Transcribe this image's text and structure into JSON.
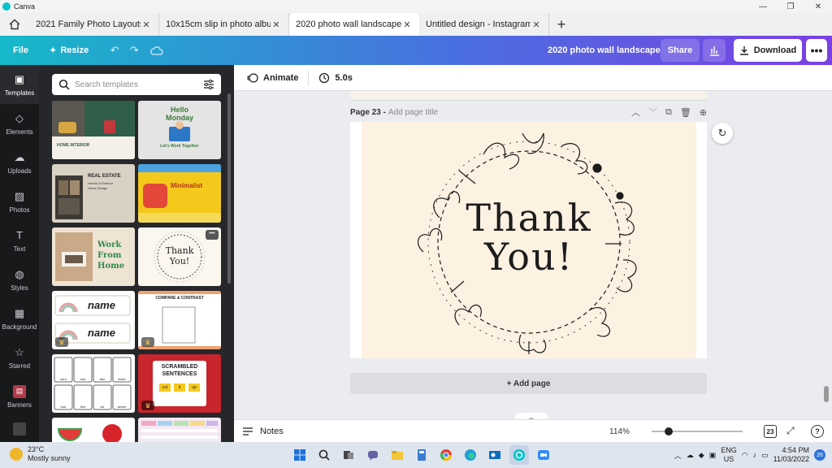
{
  "window": {
    "app_title": "Canva"
  },
  "tabs": [
    {
      "label": "2021 Family Photo Layouts",
      "active": false
    },
    {
      "label": "10x15cm slip in photo album",
      "active": false
    },
    {
      "label": "2020 photo wall landscape",
      "active": true
    },
    {
      "label": "Untitled design - Instagram",
      "active": false
    }
  ],
  "toolbar": {
    "file_label": "File",
    "resize_label": "Resize",
    "doc_title": "2020 photo wall landscape",
    "share_label": "Share",
    "download_label": "Download"
  },
  "sidebar": {
    "items": [
      {
        "label": "Templates",
        "icon": "templates-icon"
      },
      {
        "label": "Elements",
        "icon": "elements-icon"
      },
      {
        "label": "Uploads",
        "icon": "uploads-icon"
      },
      {
        "label": "Photos",
        "icon": "photos-icon"
      },
      {
        "label": "Text",
        "icon": "text-icon"
      },
      {
        "label": "Styles",
        "icon": "styles-icon"
      },
      {
        "label": "Background",
        "icon": "background-icon"
      },
      {
        "label": "Starred",
        "icon": "star-icon"
      },
      {
        "label": "Banners",
        "icon": "banners-icon"
      }
    ]
  },
  "search": {
    "placeholder": "Search templates"
  },
  "templates": [
    {
      "lines": [
        "HOME INTERIOR"
      ],
      "bg": "#e8e2d8"
    },
    {
      "lines": [
        "Hello",
        "Monday",
        "Let's Work Together"
      ],
      "bg": "#e4e4e4"
    },
    {
      "lines": [
        "REAL ESTATE",
        "Interior & Exterior",
        "Home Design"
      ],
      "bg": "#d9d2c4"
    },
    {
      "lines": [
        "Minimalist"
      ],
      "bg": "#f5c81c"
    },
    {
      "lines": [
        "Work",
        "From",
        "Home"
      ],
      "bg": "#efe4d4"
    },
    {
      "lines": [
        "Thank",
        "You!"
      ],
      "bg": "#fbf6ee"
    },
    {
      "lines": [
        "name",
        "name"
      ],
      "bg": "#ffffff"
    },
    {
      "lines": [
        "COMPARE & CONTRAST"
      ],
      "bg": "#ffffff"
    },
    {
      "lines": [
        "zero",
        "one",
        "two",
        "three",
        "four",
        "five",
        "six",
        "seven"
      ],
      "bg": "#ffffff"
    },
    {
      "lines": [
        "SCRAMBLED",
        "SENTENCES",
        "cut",
        "it",
        "up"
      ],
      "bg": "#c8252c"
    },
    {
      "lines": [],
      "bg": "#ffffff"
    },
    {
      "lines": [],
      "bg": "#f4e8f2"
    }
  ],
  "editor": {
    "animate_label": "Animate",
    "duration_label": "5.0s",
    "page_number": "Page 23 -",
    "page_title_placeholder": "Add page title",
    "canvas_line1": "Thank",
    "canvas_line2": "You!",
    "add_page_label": "+ Add page",
    "notes_label": "Notes",
    "zoom_label": "114%",
    "zoom_fraction": 0.19,
    "page_count": "23"
  },
  "taskbar": {
    "temp": "23°C",
    "weather": "Mostly sunny",
    "lang1": "ENG",
    "lang2": "US",
    "time": "4:54 PM",
    "date": "11/03/2022",
    "notifications": "26"
  },
  "colors": {
    "toolbar_start": "#16b9c9",
    "toolbar_end": "#7b3fe4",
    "canvas_bg": "#fdf1e2",
    "rail_bg": "#18191b",
    "panel_bg": "#26272b"
  }
}
